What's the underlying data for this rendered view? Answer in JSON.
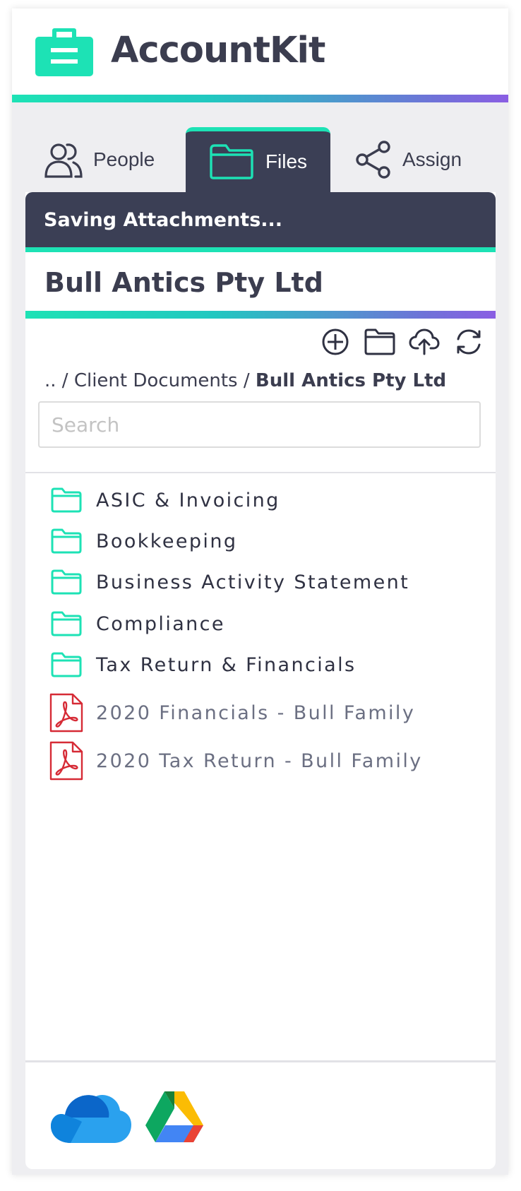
{
  "app": {
    "title": "AccountKit"
  },
  "colors": {
    "accent": "#1de2b5",
    "dark": "#3b3f55",
    "gradient_end": "#8a5ee3",
    "pdf_red": "#d62b36"
  },
  "tabs": [
    {
      "label": "People",
      "icon": "people-icon",
      "active": false
    },
    {
      "label": "Files",
      "icon": "folder-icon",
      "active": true
    },
    {
      "label": "Assign",
      "icon": "share-icon",
      "active": false
    }
  ],
  "status": {
    "text": "Saving Attachments..."
  },
  "client": {
    "name": "Bull Antics Pty Ltd"
  },
  "toolbar": {
    "icons": [
      "add-circle-icon",
      "new-folder-icon",
      "upload-cloud-icon",
      "refresh-icon"
    ]
  },
  "breadcrumb": {
    "up": "..",
    "separator": "/",
    "parent": "Client Documents",
    "current": "Bull Antics Pty Ltd"
  },
  "search": {
    "placeholder": "Search",
    "value": ""
  },
  "files": {
    "items": [
      {
        "type": "folder",
        "name": "ASIC & Invoicing"
      },
      {
        "type": "folder",
        "name": "Bookkeeping"
      },
      {
        "type": "folder",
        "name": "Business Activity Statement"
      },
      {
        "type": "folder",
        "name": "Compliance"
      },
      {
        "type": "folder",
        "name": "Tax Return & Financials"
      },
      {
        "type": "pdf",
        "name": "2020 Financials - Bull Family"
      },
      {
        "type": "pdf",
        "name": "2020 Tax Return - Bull Family"
      }
    ]
  },
  "storage": {
    "providers": [
      "onedrive-icon",
      "google-drive-icon"
    ]
  }
}
